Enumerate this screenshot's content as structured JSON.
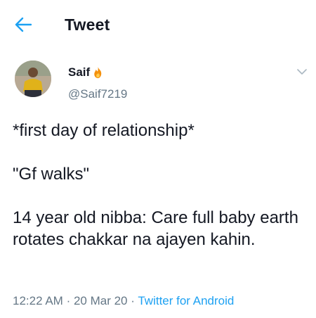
{
  "header": {
    "title": "Tweet",
    "back_icon": "arrow-left-icon",
    "accent": "#1da1f2"
  },
  "author": {
    "display_name": "Saif",
    "emoji_icon": "fire-icon",
    "handle": "@Saif7219"
  },
  "tweet": {
    "lines": [
      "*first day of relationship*",
      "",
      "\"Gf walks\"",
      "",
      "14 year old nibba: Care full baby earth rotates chakkar na ajayen kahin."
    ],
    "time": "12:22 AM",
    "separator": "·",
    "date": "20 Mar 20",
    "source": "Twitter for Android"
  },
  "colors": {
    "text": "#141823",
    "secondary": "#657786",
    "link": "#1da1f2"
  }
}
